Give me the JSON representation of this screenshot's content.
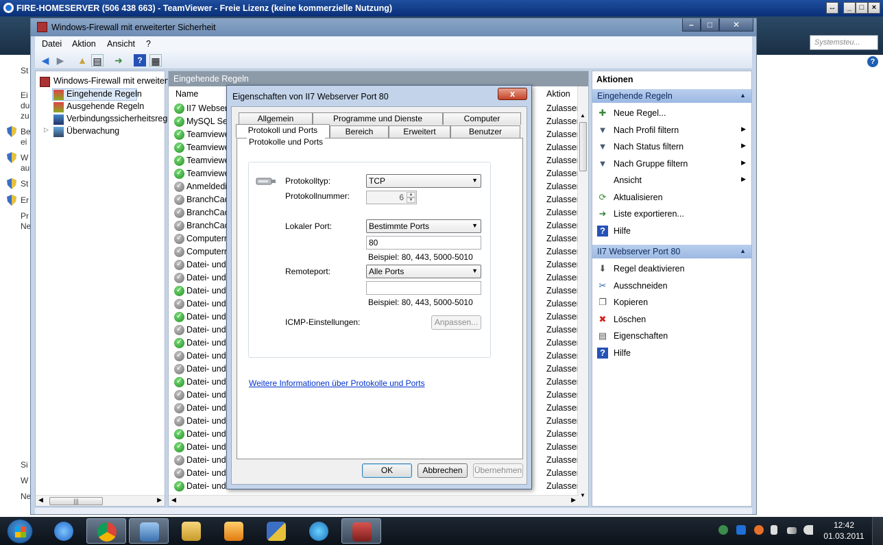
{
  "teamviewer": {
    "title": "FIRE-HOMESERVER (506 438 663) - TeamViewer - Freie Lizenz (keine kommerzielle Nutzung)"
  },
  "background": {
    "search_placeholder": "Systemsteu...",
    "left_fragments": [
      "St",
      "Ei",
      "du",
      "zu",
      "Be",
      "ei",
      "W",
      "au",
      "St",
      "Er",
      "Pr",
      "Ne",
      "Si",
      "W",
      "Ne"
    ]
  },
  "mmc": {
    "title": "Windows-Firewall mit erweiterter Sicherheit",
    "menu": [
      "Datei",
      "Aktion",
      "Ansicht",
      "?"
    ],
    "tree": {
      "root": "Windows-Firewall mit erweitert",
      "items": [
        "Eingehende Regeln",
        "Ausgehende Regeln",
        "Verbindungssicherheitsrege",
        "Überwachung"
      ]
    },
    "center": {
      "header": "Eingehende Regeln",
      "col_name": "Name",
      "col_action": "Aktion",
      "rows": [
        {
          "name": "II7 Webserv",
          "enabled": true,
          "action": "Zulasser"
        },
        {
          "name": "MySQL Serv",
          "enabled": true,
          "action": "Zulasser"
        },
        {
          "name": "Teamviewe",
          "enabled": true,
          "action": "Zulasser"
        },
        {
          "name": "Teamviewe",
          "enabled": true,
          "action": "Zulasser"
        },
        {
          "name": "Teamviewe",
          "enabled": true,
          "action": "Zulasser"
        },
        {
          "name": "Teamviewe",
          "enabled": true,
          "action": "Zulasser"
        },
        {
          "name": "Anmeldedi",
          "enabled": false,
          "action": "Zulasser"
        },
        {
          "name": "BranchCacl",
          "enabled": false,
          "action": "Zulasser"
        },
        {
          "name": "BranchCacl",
          "enabled": false,
          "action": "Zulasser"
        },
        {
          "name": "BranchCacl",
          "enabled": false,
          "action": "Zulasser"
        },
        {
          "name": "Computern",
          "enabled": false,
          "action": "Zulasser"
        },
        {
          "name": "Computern",
          "enabled": false,
          "action": "Zulasser"
        },
        {
          "name": "Datei- und",
          "enabled": false,
          "action": "Zulasser"
        },
        {
          "name": "Datei- und",
          "enabled": false,
          "action": "Zulasser"
        },
        {
          "name": "Datei- und",
          "enabled": true,
          "action": "Zulasser"
        },
        {
          "name": "Datei- und",
          "enabled": false,
          "action": "Zulasser"
        },
        {
          "name": "Datei- und",
          "enabled": true,
          "action": "Zulasser"
        },
        {
          "name": "Datei- und",
          "enabled": false,
          "action": "Zulasser"
        },
        {
          "name": "Datei- und",
          "enabled": true,
          "action": "Zulasser"
        },
        {
          "name": "Datei- und",
          "enabled": false,
          "action": "Zulasser"
        },
        {
          "name": "Datei- und",
          "enabled": false,
          "action": "Zulasser"
        },
        {
          "name": "Datei- und",
          "enabled": true,
          "action": "Zulasser"
        },
        {
          "name": "Datei- und",
          "enabled": false,
          "action": "Zulasser"
        },
        {
          "name": "Datei- und",
          "enabled": false,
          "action": "Zulasser"
        },
        {
          "name": "Datei- und",
          "enabled": false,
          "action": "Zulasser"
        },
        {
          "name": "Datei- und",
          "enabled": true,
          "action": "Zulasser"
        },
        {
          "name": "Datei- und",
          "enabled": true,
          "action": "Zulasser"
        },
        {
          "name": "Datei- und",
          "enabled": false,
          "action": "Zulasser"
        },
        {
          "name": "Datei- und",
          "enabled": false,
          "action": "Zulasser"
        },
        {
          "name": "Datei- und",
          "enabled": true,
          "action": "Zulasser"
        }
      ]
    },
    "actions": {
      "header": "Aktionen",
      "section1": "Eingehende Regeln",
      "section1_items": [
        {
          "label": "Neue Regel...",
          "icon": "new-rule-icon",
          "submenu": false
        },
        {
          "label": "Nach Profil filtern",
          "icon": "filter-icon",
          "submenu": true
        },
        {
          "label": "Nach Status filtern",
          "icon": "filter-icon",
          "submenu": true
        },
        {
          "label": "Nach Gruppe filtern",
          "icon": "filter-icon",
          "submenu": true
        },
        {
          "label": "Ansicht",
          "icon": "",
          "submenu": true
        },
        {
          "label": "Aktualisieren",
          "icon": "refresh-icon",
          "submenu": false
        },
        {
          "label": "Liste exportieren...",
          "icon": "export-icon",
          "submenu": false
        },
        {
          "label": "Hilfe",
          "icon": "help-icon",
          "submenu": false
        }
      ],
      "section2": "II7 Webserver Port 80",
      "section2_items": [
        {
          "label": "Regel deaktivieren",
          "icon": "disable-icon"
        },
        {
          "label": "Ausschneiden",
          "icon": "cut-icon"
        },
        {
          "label": "Kopieren",
          "icon": "copy-icon"
        },
        {
          "label": "Löschen",
          "icon": "delete-icon"
        },
        {
          "label": "Eigenschaften",
          "icon": "properties-icon"
        },
        {
          "label": "Hilfe",
          "icon": "help-icon"
        }
      ]
    }
  },
  "dialog": {
    "title": "Eigenschaften von II7 Webserver Port 80",
    "close": "x",
    "tabs_row1": [
      "Allgemein",
      "Programme und Dienste",
      "Computer"
    ],
    "tabs_row2": [
      "Protokoll und Ports",
      "Bereich",
      "Erweitert",
      "Benutzer"
    ],
    "group_label": "Protokolle und Ports",
    "protocol_type_label": "Protokolltyp:",
    "protocol_type_value": "TCP",
    "protocol_number_label": "Protokollnummer:",
    "protocol_number_value": "6",
    "local_port_label": "Lokaler Port:",
    "local_port_mode": "Bestimmte Ports",
    "local_port_value": "80",
    "local_port_example": "Beispiel: 80, 443, 5000-5010",
    "remote_port_label": "Remoteport:",
    "remote_port_mode": "Alle Ports",
    "remote_port_value": "",
    "remote_port_example": "Beispiel: 80, 443, 5000-5010",
    "icmp_label": "ICMP-Einstellungen:",
    "icmp_button": "Anpassen...",
    "more_info_link": "Weitere Informationen über Protokolle und Ports",
    "ok": "OK",
    "cancel": "Abbrechen",
    "apply": "Übernehmen"
  },
  "taskbar": {
    "time": "12:42",
    "date": "01.03.2011"
  }
}
